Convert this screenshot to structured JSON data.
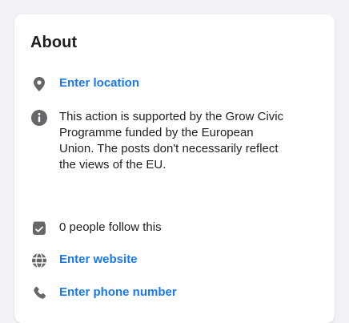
{
  "about": {
    "title": "About",
    "location_label": "Enter location",
    "info_text": "This action is supported by the Grow Civic Programme funded by the European Union. The posts don't necessarily reflect the views of the EU.",
    "followers_text": "0 people follow this",
    "website_label": "Enter website",
    "phone_label": "Enter phone number"
  },
  "icons": {
    "location": "location-pin-icon",
    "info": "info-icon",
    "followers": "follow-box-icon",
    "website": "globe-icon",
    "phone": "phone-icon"
  },
  "colors": {
    "link": "#1877f2",
    "icon": "#65676b",
    "background": "#f0f2f5",
    "card": "#ffffff"
  }
}
